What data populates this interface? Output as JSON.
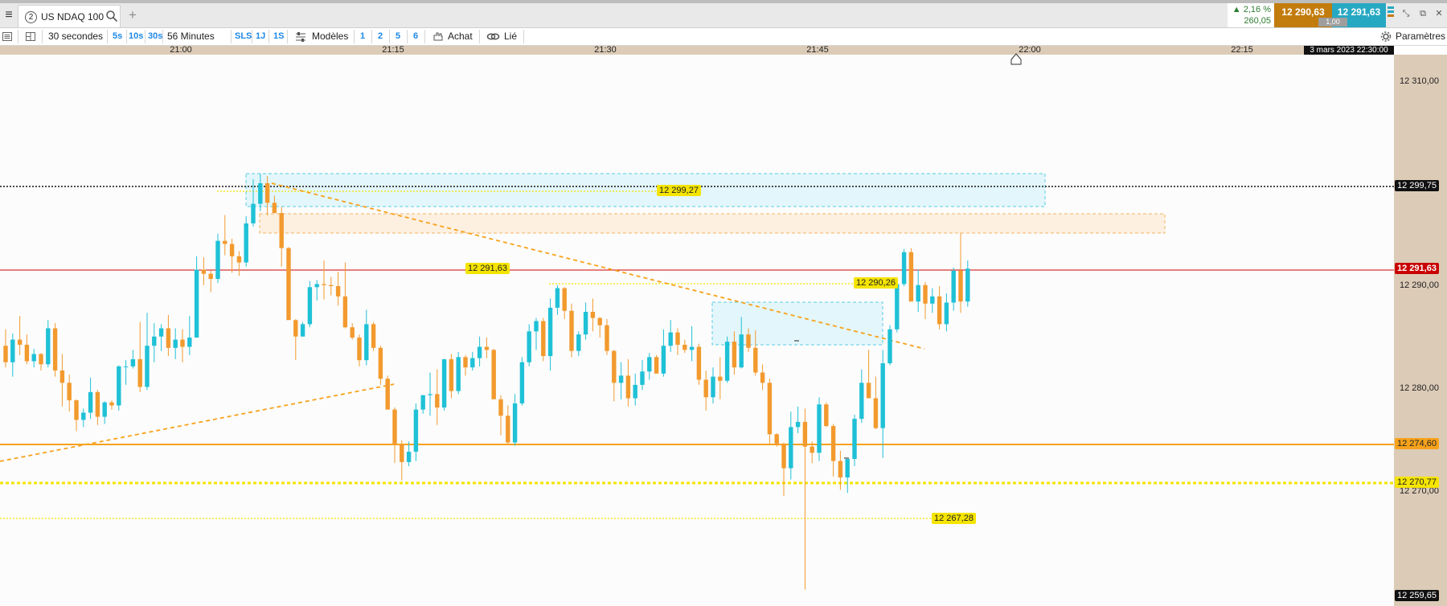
{
  "window": {
    "tab_number": "2",
    "tab_title": "US NDAQ 100",
    "quote_change_pct": "▲ 2,16 %",
    "quote_change_pts": "260,05",
    "bid": "12 290,63",
    "ask": "12 291,63",
    "quantity": "1,00"
  },
  "toolbar": {
    "interval": "30 secondes",
    "intervals": [
      "5s",
      "10s",
      "30s"
    ],
    "duration": "56 Minutes",
    "ranges": [
      "SLS",
      "1J",
      "1S"
    ],
    "templates_label": "Modèles",
    "numbers": [
      "1",
      "2",
      "5",
      "6"
    ],
    "buy_label": "Achat",
    "linked_label": "Lié",
    "settings_label": "Paramètres"
  },
  "colors": {
    "up": "#1fc1d6",
    "down": "#f29a2e",
    "axis_bg": "#dccbb7",
    "last_price": "#c80000",
    "level_orange": "#f7a21b",
    "level_yellow": "#f5e400"
  },
  "chart_data": {
    "type": "candlestick",
    "instrument": "US NDAQ 100",
    "timeframe": "30 secondes",
    "date_label": "3 mars 2023 22:30:00",
    "x_ticks": [
      "21:00",
      "21:15",
      "21:30",
      "21:45",
      "22:00",
      "22:15"
    ],
    "y_ticks": [
      "12 310,00",
      "12 290,00",
      "12 280,00",
      "12 270,00"
    ],
    "y_tick_values": [
      12310,
      12290,
      12280,
      12270
    ],
    "ylim": [
      12258.5,
      12312.4
    ],
    "time_start": "20:45:30",
    "candle_step_seconds": 30,
    "price_markers": [
      {
        "label": "12 299,75",
        "value": 12299.75,
        "style": "dark"
      },
      {
        "label": "12 291,63",
        "value": 12291.63,
        "style": "last"
      },
      {
        "label": "12 274,60",
        "value": 12274.6,
        "style": "orange"
      },
      {
        "label": "12 270,77",
        "value": 12270.77,
        "style": "yellow"
      },
      {
        "label": "12 259,65",
        "value": 12259.65,
        "style": "dark"
      }
    ],
    "level_labels": [
      {
        "label": "12 299,27",
        "value": 12299.27
      },
      {
        "label": "12 291,63",
        "value": 12291.63
      },
      {
        "label": "12 290,26",
        "value": 12290.26
      },
      {
        "label": "12 267,28",
        "value": 12267.28
      }
    ],
    "candles": [
      [
        12284.2,
        12285.8,
        12282.1,
        12282.6
      ],
      [
        12282.6,
        12285.4,
        12281.2,
        12284.8
      ],
      [
        12284.8,
        12287.1,
        12283.3,
        12284.3
      ],
      [
        12284.3,
        12285.3,
        12282.4,
        12282.7
      ],
      [
        12282.7,
        12283.9,
        12282.1,
        12283.4
      ],
      [
        12283.4,
        12283.5,
        12281.8,
        12282.4
      ],
      [
        12282.4,
        12286.7,
        12282.1,
        12285.9
      ],
      [
        12285.9,
        12286.4,
        12281.2,
        12281.8
      ],
      [
        12281.8,
        12283.4,
        12278.3,
        12280.6
      ],
      [
        12280.6,
        12281.4,
        12277.8,
        12278.9
      ],
      [
        12278.9,
        12279.0,
        12275.9,
        12277.0
      ],
      [
        12277.0,
        12278.1,
        12276.3,
        12277.7
      ],
      [
        12277.7,
        12281.1,
        12277.1,
        12279.7
      ],
      [
        12279.7,
        12279.9,
        12276.5,
        12277.3
      ],
      [
        12277.3,
        12278.8,
        12276.6,
        12278.7
      ],
      [
        12278.7,
        12278.9,
        12278.0,
        12278.4
      ],
      [
        12278.4,
        12282.3,
        12277.9,
        12282.2
      ],
      [
        12282.2,
        12282.8,
        12280.4,
        12282.2
      ],
      [
        12282.2,
        12283.8,
        12282.0,
        12282.9
      ],
      [
        12282.9,
        12286.5,
        12279.7,
        12280.2
      ],
      [
        12280.2,
        12287.4,
        12279.9,
        12284.2
      ],
      [
        12284.2,
        12286.4,
        12282.6,
        12285.1
      ],
      [
        12285.1,
        12286.3,
        12283.7,
        12285.9
      ],
      [
        12285.9,
        12287.2,
        12283.2,
        12284.0
      ],
      [
        12284.0,
        12285.9,
        12282.9,
        12284.8
      ],
      [
        12284.8,
        12285.8,
        12282.6,
        12284.1
      ],
      [
        12284.1,
        12287.1,
        12283.3,
        12285.0
      ],
      [
        12285.0,
        12292.9,
        12285.0,
        12291.6
      ],
      [
        12291.6,
        12292.8,
        12290.1,
        12291.2
      ],
      [
        12291.2,
        12291.5,
        12289.4,
        12290.7
      ],
      [
        12290.7,
        12295.1,
        12290.3,
        12294.4
      ],
      [
        12294.4,
        12296.9,
        12293.0,
        12294.1
      ],
      [
        12294.1,
        12294.6,
        12291.3,
        12292.9
      ],
      [
        12292.9,
        12293.4,
        12291.0,
        12292.3
      ],
      [
        12292.3,
        12296.8,
        12291.9,
        12296.1
      ],
      [
        12296.1,
        12300.4,
        12295.8,
        12298.0
      ],
      [
        12298.0,
        12300.9,
        12297.3,
        12300.0
      ],
      [
        12300.0,
        12300.7,
        12296.9,
        12298.1
      ],
      [
        12298.1,
        12298.8,
        12297.2,
        12297.1
      ],
      [
        12297.1,
        12297.7,
        12291.9,
        12293.7
      ],
      [
        12293.7,
        12293.8,
        12287.5,
        12286.7
      ],
      [
        12286.7,
        12286.8,
        12282.8,
        12285.1
      ],
      [
        12285.1,
        12286.5,
        12285.1,
        12286.3
      ],
      [
        12286.3,
        12290.5,
        12286.0,
        12289.9
      ],
      [
        12289.9,
        12290.6,
        12288.6,
        12290.2
      ],
      [
        12290.2,
        12292.5,
        12288.7,
        12290.1
      ],
      [
        12290.1,
        12290.9,
        12289.1,
        12290.0
      ],
      [
        12290.0,
        12291.4,
        12288.1,
        12289.0
      ],
      [
        12289.0,
        12292.3,
        12285.9,
        12286.0
      ],
      [
        12286.0,
        12286.4,
        12284.8,
        12285.0
      ],
      [
        12285.0,
        12285.3,
        12282.2,
        12282.8
      ],
      [
        12282.8,
        12287.7,
        12282.3,
        12286.3
      ],
      [
        12286.3,
        12286.5,
        12283.7,
        12284.0
      ],
      [
        12284.0,
        12284.2,
        12280.4,
        12281.0
      ],
      [
        12281.0,
        12281.3,
        12278.0,
        12278.0
      ],
      [
        12278.0,
        12278.2,
        12272.8,
        12274.6
      ],
      [
        12274.6,
        12275.0,
        12271.1,
        12272.9
      ],
      [
        12272.9,
        12274.9,
        12272.5,
        12273.9
      ],
      [
        12273.9,
        12278.6,
        12273.0,
        12278.0
      ],
      [
        12278.0,
        12279.4,
        12277.6,
        12279.4
      ],
      [
        12279.4,
        12281.6,
        12277.4,
        12279.5
      ],
      [
        12279.5,
        12281.9,
        12276.5,
        12278.2
      ],
      [
        12278.2,
        12282.9,
        12277.9,
        12282.9
      ],
      [
        12282.9,
        12283.4,
        12279.1,
        12279.8
      ],
      [
        12279.8,
        12283.6,
        12279.5,
        12283.1
      ],
      [
        12283.1,
        12283.3,
        12281.3,
        12282.1
      ],
      [
        12282.1,
        12283.6,
        12281.8,
        12283.0
      ],
      [
        12283.0,
        12285.1,
        12282.2,
        12284.1
      ],
      [
        12284.1,
        12285.0,
        12283.0,
        12283.8
      ],
      [
        12283.8,
        12283.9,
        12279.2,
        12279.0
      ],
      [
        12279.0,
        12279.4,
        12275.5,
        12277.4
      ],
      [
        12277.4,
        12278.4,
        12274.6,
        12274.8
      ],
      [
        12274.8,
        12279.5,
        12274.5,
        12278.6
      ],
      [
        12278.6,
        12283.1,
        12278.4,
        12282.6
      ],
      [
        12282.6,
        12286.3,
        12282.2,
        12285.6
      ],
      [
        12285.6,
        12286.9,
        12283.8,
        12286.6
      ],
      [
        12286.6,
        12286.9,
        12282.7,
        12283.2
      ],
      [
        12283.2,
        12288.8,
        12281.8,
        12287.9
      ],
      [
        12287.9,
        12290.1,
        12287.2,
        12289.8
      ],
      [
        12289.8,
        12289.9,
        12286.8,
        12287.6
      ],
      [
        12287.6,
        12288.3,
        12283.1,
        12283.7
      ],
      [
        12283.7,
        12285.6,
        12283.2,
        12285.3
      ],
      [
        12285.3,
        12288.4,
        12284.8,
        12287.5
      ],
      [
        12287.5,
        12288.8,
        12285.6,
        12286.9
      ],
      [
        12286.9,
        12287.0,
        12285.0,
        12286.2
      ],
      [
        12286.2,
        12286.8,
        12283.3,
        12283.7
      ],
      [
        12283.7,
        12283.8,
        12278.8,
        12280.6
      ],
      [
        12280.6,
        12282.6,
        12279.0,
        12281.3
      ],
      [
        12281.3,
        12282.9,
        12278.3,
        12279.1
      ],
      [
        12279.1,
        12281.5,
        12278.4,
        12280.4
      ],
      [
        12280.4,
        12282.8,
        12279.9,
        12281.7
      ],
      [
        12281.7,
        12283.5,
        12280.9,
        12283.1
      ],
      [
        12283.1,
        12283.3,
        12281.6,
        12281.5
      ],
      [
        12281.5,
        12285.8,
        12281.2,
        12284.2
      ],
      [
        12284.2,
        12286.7,
        12283.6,
        12285.5
      ],
      [
        12285.5,
        12285.9,
        12283.3,
        12284.3
      ],
      [
        12284.3,
        12284.8,
        12283.5,
        12283.8
      ],
      [
        12283.8,
        12286.1,
        12282.7,
        12284.1
      ],
      [
        12284.1,
        12284.4,
        12280.4,
        12280.9
      ],
      [
        12280.9,
        12281.8,
        12277.9,
        12279.2
      ],
      [
        12279.2,
        12282.1,
        12278.6,
        12281.2
      ],
      [
        12281.2,
        12283.1,
        12279.0,
        12280.8
      ],
      [
        12280.8,
        12285.1,
        12280.6,
        12284.6
      ],
      [
        12284.6,
        12285.6,
        12281.4,
        12282.1
      ],
      [
        12282.1,
        12287.0,
        12282.0,
        12285.3
      ],
      [
        12285.3,
        12285.9,
        12283.6,
        12284.0
      ],
      [
        12284.0,
        12285.7,
        12281.3,
        12281.6
      ],
      [
        12281.6,
        12282.4,
        12279.9,
        12280.6
      ],
      [
        12280.6,
        12281.0,
        12274.6,
        12275.6
      ],
      [
        12275.6,
        12275.7,
        12274.4,
        12274.6
      ],
      [
        12274.6,
        12274.8,
        12269.6,
        12272.3
      ],
      [
        12272.3,
        12277.8,
        12271.2,
        12276.3
      ],
      [
        12276.3,
        12278.3,
        12275.7,
        12276.8
      ],
      [
        12276.8,
        12278.1,
        12260.5,
        12274.4
      ],
      [
        12274.4,
        12274.9,
        12272.8,
        12273.8
      ],
      [
        12273.8,
        12279.2,
        12273.0,
        12278.5
      ],
      [
        12278.5,
        12278.7,
        12276.3,
        12276.4
      ],
      [
        12276.4,
        12276.6,
        12271.5,
        12273.0
      ],
      [
        12273.0,
        12274.0,
        12270.2,
        12271.4
      ],
      [
        12271.4,
        12272.9,
        12269.9,
        12273.2
      ],
      [
        12273.2,
        12277.5,
        12272.5,
        12277.1
      ],
      [
        12277.1,
        12281.9,
        12276.7,
        12280.6
      ],
      [
        12280.6,
        12283.8,
        12279.6,
        12279.1
      ],
      [
        12279.1,
        12281.2,
        12276.1,
        12276.2
      ],
      [
        12276.2,
        12283.8,
        12273.3,
        12282.5
      ],
      [
        12282.5,
        12286.2,
        12282.3,
        12285.8
      ],
      [
        12285.8,
        12289.9,
        12285.5,
        12290.2
      ],
      [
        12290.2,
        12293.6,
        12290.0,
        12293.3
      ],
      [
        12293.3,
        12293.7,
        12289.4,
        12288.5
      ],
      [
        12288.5,
        12291.6,
        12287.5,
        12290.1
      ],
      [
        12290.1,
        12290.4,
        12286.8,
        12288.3
      ],
      [
        12288.3,
        12289.8,
        12287.4,
        12289.0
      ],
      [
        12289.0,
        12290.0,
        12285.8,
        12286.3
      ],
      [
        12286.3,
        12289.3,
        12285.6,
        12288.4
      ],
      [
        12288.4,
        12291.8,
        12287.6,
        12291.5
      ],
      [
        12291.5,
        12295.2,
        12287.4,
        12288.5
      ],
      [
        12288.5,
        12292.5,
        12288.0,
        12291.7
      ]
    ]
  }
}
